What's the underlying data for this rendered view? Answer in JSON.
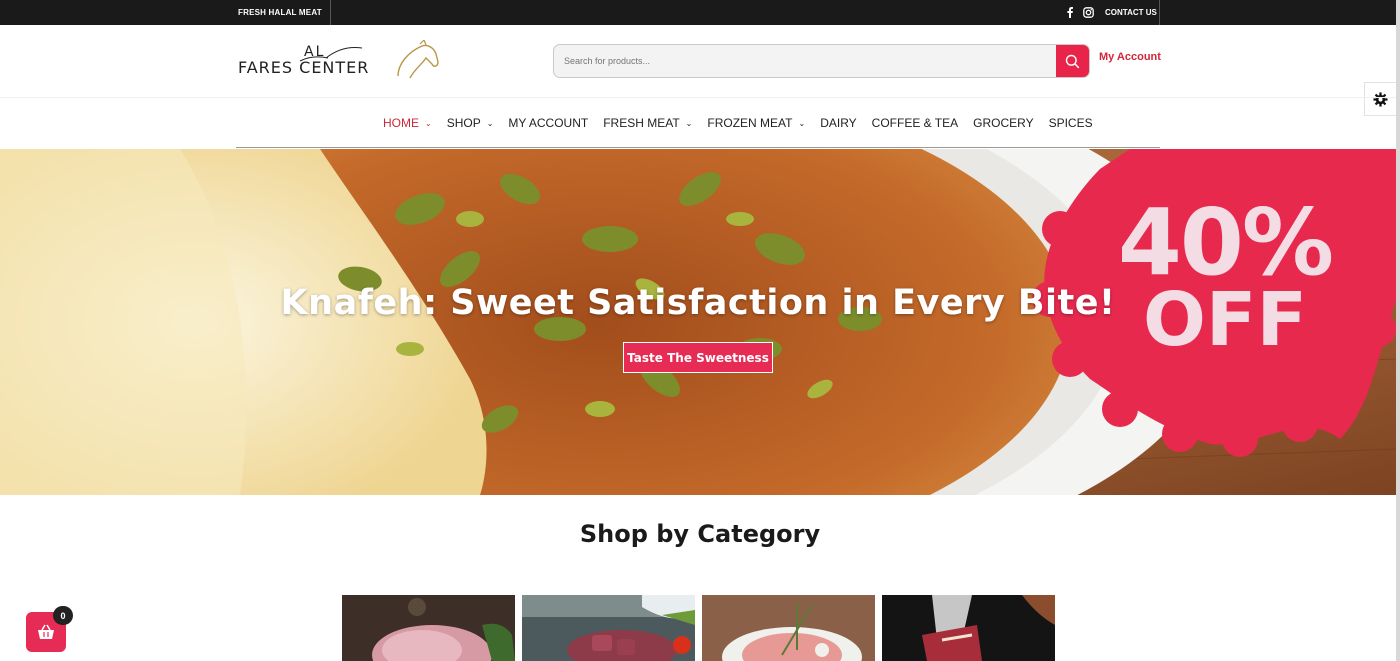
{
  "topbar": {
    "left_text": "FRESH HALAL MEAT",
    "contact": "CONTACT US",
    "social_icons": [
      "facebook-icon",
      "instagram-icon"
    ]
  },
  "header": {
    "logo_line1": "AL",
    "logo_line2": "FARES CENTER",
    "search_placeholder": "Search for products...",
    "my_account": "My Account"
  },
  "nav": {
    "items": [
      {
        "label": "HOME",
        "dropdown": true,
        "active": true
      },
      {
        "label": "SHOP",
        "dropdown": true
      },
      {
        "label": "MY ACCOUNT",
        "dropdown": false
      },
      {
        "label": "FRESH MEAT",
        "dropdown": true
      },
      {
        "label": "FROZEN MEAT",
        "dropdown": true
      },
      {
        "label": "DAIRY",
        "dropdown": false
      },
      {
        "label": "COFFEE & TEA",
        "dropdown": false
      },
      {
        "label": "GROCERY",
        "dropdown": false
      },
      {
        "label": "SPICES",
        "dropdown": false
      }
    ]
  },
  "hero": {
    "title": "Knafeh: Sweet Satisfaction in Every Bite!",
    "button": "Taste The Sweetness",
    "badge_percent": "40%",
    "badge_off": "OFF"
  },
  "categories": {
    "heading": "Shop by Category"
  },
  "cart": {
    "count": "0"
  },
  "colors": {
    "accent": "#e62b54",
    "nav_active": "#c9283b",
    "topbar_bg": "#1a1a1a"
  }
}
